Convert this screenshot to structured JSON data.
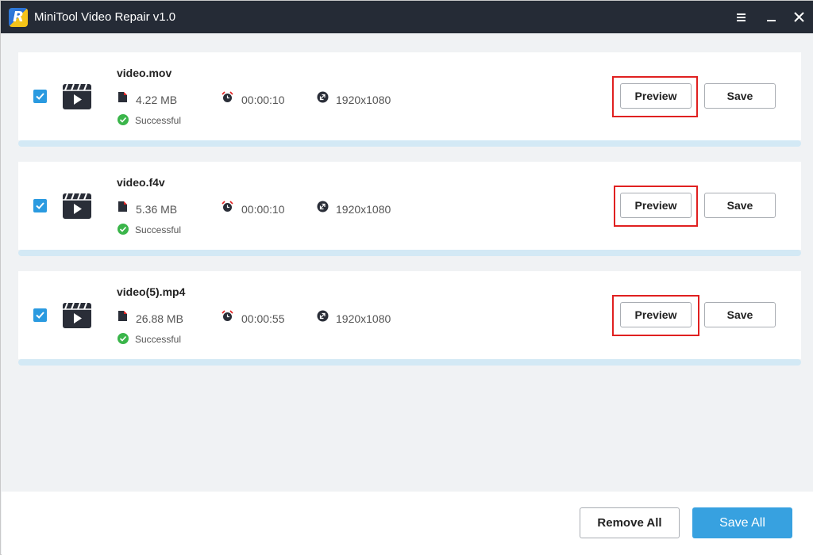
{
  "window": {
    "title": "MiniTool Video Repair v1.0",
    "logo_letter": "R"
  },
  "colors": {
    "titlebar": "#252b36",
    "accent": "#37a1e0",
    "checkbox": "#2a9ae0",
    "success": "#3ab54a",
    "highlight": "#e02020",
    "progress_track": "#d3e9f5"
  },
  "files": [
    {
      "name": "video.mov",
      "size": "4.22 MB",
      "duration": "00:00:10",
      "resolution": "1920x1080",
      "status": "Successful",
      "checked": true,
      "preview_label": "Preview",
      "save_label": "Save"
    },
    {
      "name": "video.f4v",
      "size": "5.36 MB",
      "duration": "00:00:10",
      "resolution": "1920x1080",
      "status": "Successful",
      "checked": true,
      "preview_label": "Preview",
      "save_label": "Save"
    },
    {
      "name": "video(5).mp4",
      "size": "26.88 MB",
      "duration": "00:00:55",
      "resolution": "1920x1080",
      "status": "Successful",
      "checked": true,
      "preview_label": "Preview",
      "save_label": "Save"
    }
  ],
  "footer": {
    "remove_all_label": "Remove All",
    "save_all_label": "Save All"
  },
  "icons": {
    "menu": "hamburger-menu-icon",
    "minimize": "minimize-icon",
    "close": "close-icon",
    "file": "clapperboard-play-icon",
    "size": "document-icon",
    "duration": "alarm-clock-icon",
    "resolution": "resolution-icon",
    "status": "check-circle-icon"
  }
}
